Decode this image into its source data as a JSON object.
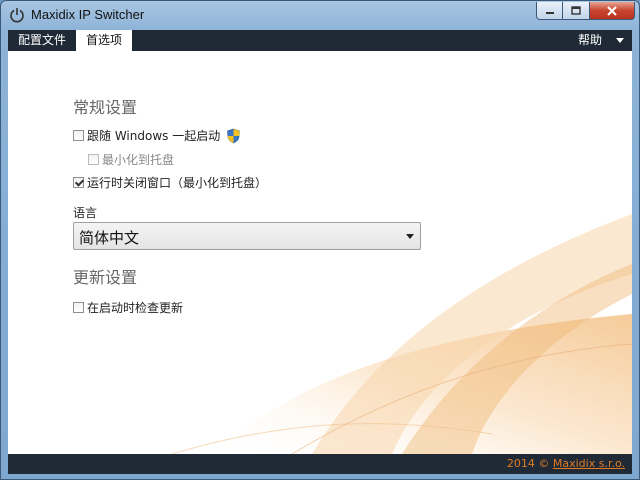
{
  "window": {
    "title": "Maxidix IP Switcher"
  },
  "menubar": {
    "tabs": [
      {
        "label": "配置文件"
      },
      {
        "label": "首选项"
      }
    ],
    "help": "帮助"
  },
  "general": {
    "title": "常规设置",
    "startup_with_windows": {
      "label": "跟随 Windows 一起启动",
      "checked": false
    },
    "minimize_to_tray": {
      "label": "最小化到托盘",
      "checked": false,
      "enabled": false
    },
    "close_to_tray": {
      "label": "运行时关闭窗口（最小化到托盘）",
      "checked": true
    },
    "language_label": "语言",
    "language_value": "简体中文"
  },
  "update": {
    "title": "更新设置",
    "check_on_start": {
      "label": "在启动时检查更新",
      "checked": false
    }
  },
  "footer": {
    "year": "2014 ©",
    "company": "Maxidix s.r.o."
  },
  "colors": {
    "menubar": "#1f2a36",
    "accent": "#e07b24"
  }
}
